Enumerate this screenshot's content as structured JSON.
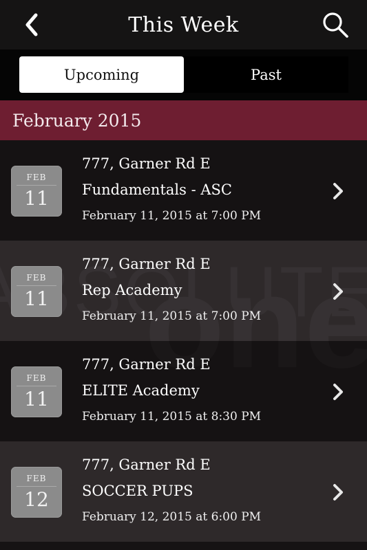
{
  "header": {
    "title": "This Week",
    "back_icon": "back-chevron-icon",
    "search_icon": "search-icon"
  },
  "tabs": [
    {
      "label": "Upcoming",
      "selected": true
    },
    {
      "label": "Past",
      "selected": false
    }
  ],
  "section": {
    "title": "February 2015"
  },
  "watermark": {
    "line1": "ABSOLUTE",
    "line2": "one"
  },
  "events": [
    {
      "month": "FEB",
      "day": "11",
      "location": "777, Garner Rd E",
      "name": "Fundamentals - ASC",
      "datetime": "February 11, 2015 at 7:00 PM"
    },
    {
      "month": "FEB",
      "day": "11",
      "location": "777, Garner Rd E",
      "name": "Rep Academy",
      "datetime": "February 11, 2015 at 7:00 PM"
    },
    {
      "month": "FEB",
      "day": "11",
      "location": "777, Garner Rd E",
      "name": "ELITE Academy",
      "datetime": "February 11, 2015 at 8:30 PM"
    },
    {
      "month": "FEB",
      "day": "12",
      "location": "777, Garner Rd E",
      "name": "SOCCER PUPS",
      "datetime": "February 12, 2015 at 6:00 PM"
    }
  ],
  "colors": {
    "accent": "#6e1e31",
    "row_dark": "#161213",
    "row_light": "#343031"
  }
}
